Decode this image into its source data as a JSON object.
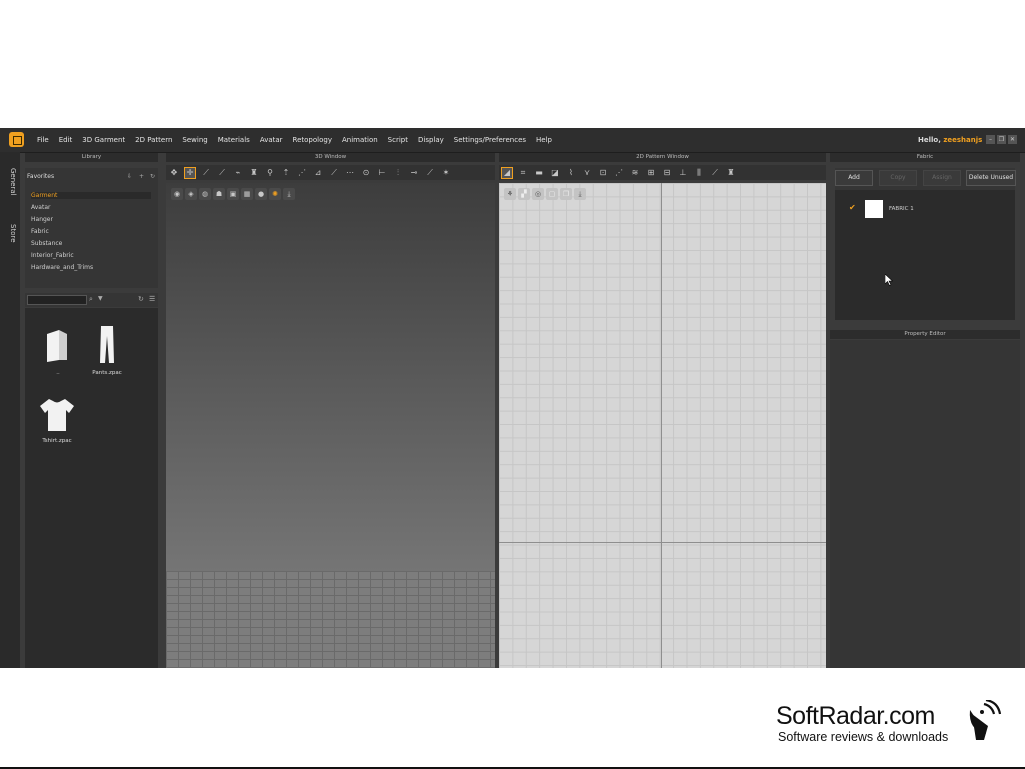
{
  "menu": [
    "File",
    "Edit",
    "3D Garment",
    "2D Pattern",
    "Sewing",
    "Materials",
    "Avatar",
    "Retopology",
    "Animation",
    "Script",
    "Display",
    "Settings/Preferences",
    "Help"
  ],
  "user": {
    "greeting": "Hello,",
    "name": "zeeshanjs"
  },
  "sidetabs": [
    "General",
    "Store"
  ],
  "library": {
    "title": "Library",
    "favorites_label": "Favorites",
    "favorites": [
      "Garment",
      "Avatar",
      "Hanger",
      "Fabric",
      "Substance",
      "Interior_Fabric",
      "Hardware_and_Trims"
    ],
    "files": [
      {
        "name": "..",
        "icon": "folder-icon"
      },
      {
        "name": "Pants.zpac",
        "icon": "pants-icon"
      },
      {
        "name": "Tshirt.zpac",
        "icon": "tshirt-icon"
      }
    ]
  },
  "view3d": {
    "title": "3D Window"
  },
  "view2d": {
    "title": "2D Pattern Window"
  },
  "fabric": {
    "title": "Fabric",
    "buttons": {
      "add": "Add",
      "copy": "Copy",
      "assign": "Assign",
      "delete_unused": "Delete Unused"
    },
    "items": [
      {
        "name": "FABRIC 1",
        "swatch": "#ffffff",
        "checked": true
      }
    ]
  },
  "property_editor": {
    "title": "Property Editor"
  },
  "watermark": {
    "brand": "SoftRadar.com",
    "tagline": "Software reviews & downloads"
  },
  "colors": {
    "accent": "#f0a020",
    "panel": "#353535",
    "background": "#3b3b3b"
  }
}
